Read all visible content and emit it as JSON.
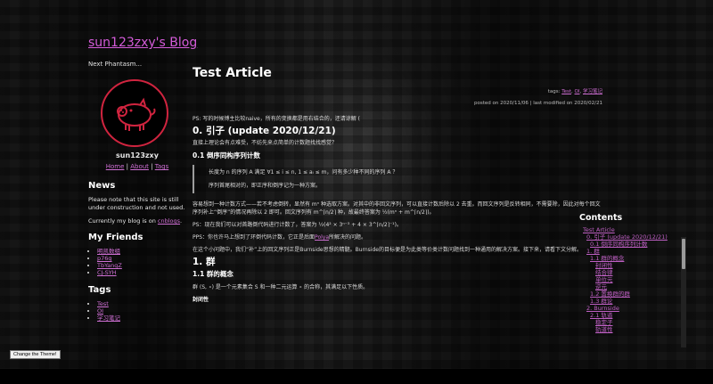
{
  "sidebar": {
    "blog_title": "sun123zxy's Blog",
    "subtitle": "Next Phantasm...",
    "username": "sun123zxy",
    "nav": {
      "home": "Home",
      "about": "About",
      "tags": "Tags"
    },
    "news": {
      "heading": "News",
      "p1": "Please note that this site is still under construction and not used.",
      "p2_prefix": "Currently my blog is on ",
      "p2_link": "cnblogs",
      "p2_suffix": "."
    },
    "friends": {
      "heading": "My Friends",
      "items": [
        "明凯数组",
        "p76g",
        "TbYangZ",
        "CJ-SYH"
      ]
    },
    "tags": {
      "heading": "Tags",
      "items": [
        "Test",
        "OI",
        "学习笔记"
      ]
    }
  },
  "article": {
    "title": "Test Article",
    "tags_label": "tags:",
    "tags": [
      "Test",
      "OI",
      "学习笔记"
    ],
    "date_line": "posted on 2020/11/06 | last modified on 2020/02/21",
    "ps1": "PS: 写的时候博主比较naive，所有的变换都是用右结合的，还请谅解 (",
    "h_intro": "0. 引子 (update 2020/12/21)",
    "intro_p": "直接上理论会有点难受，不妨先来点简单的计数题找找感觉？",
    "h_01": "0.1 倒序同构序列计数",
    "quote1": "长度为 n 的序列 A 满足 ∀1 ≤ i ≤ n, 1 ≤ aᵢ ≤ m，问有多少种不同的序列 A ？",
    "quote2": "序列首尾相对的，即正序和倒序记为一种方案。",
    "p_count": "容易想到一种计数方式——若不考虑倒转，显然有 mⁿ 种选取方案。对其中的非回文序列，可以直接计数后除以 2 去重。而回文序列是反转相同，不需要除，因此对每个回文序列补上“倒序”的情况再除以 2 即可。回文序列有 m^⌈n/2⌉ 种，故最终答案为 ½(mⁿ + m^⌈n/2⌉)。",
    "ps2": "PS：现在我们可以对首路倒代码进行计数了，答案为 ½(4² × 3ⁿ⁻³ + 4 × 3^⌈n/2⌉⁻¹)。",
    "pps_prefix": "PPS：你也许马上想到了环倒代码计数，它正是后面",
    "pps_link": "Polya",
    "pps_suffix": "所解决的问题。",
    "p_transition": "在这个小问题中，我们“补”上的回文序列正是Burnside思想的精髓。Burnside的目标便是为此类等价类计数问题找到一种通用的解决方案。接下来，请看下文分解。",
    "h_1": "1. 群",
    "h_11": "1.1 群的概念",
    "p_group": "群 (S, ∘) 是一个元素集合 S 和一种二元运算 ∘ 的合称，其满足以下性质。",
    "p_closure": "封闭性"
  },
  "toc": {
    "heading": "Contents",
    "items": [
      {
        "label": "Test Article",
        "level": 1
      },
      {
        "label": "0. 引子 (update 2020/12/21)",
        "level": 2
      },
      {
        "label": "0.1 倒序同构序列计数",
        "level": 3
      },
      {
        "label": "1. 群",
        "level": 2
      },
      {
        "label": "1.1 群的概念",
        "level": 3
      },
      {
        "label": "封闭性",
        "level": 4
      },
      {
        "label": "结合律",
        "level": 4
      },
      {
        "label": "单位元",
        "level": 4
      },
      {
        "label": "逆元",
        "level": 4
      },
      {
        "label": "1.2 置换群的群",
        "level": 3
      },
      {
        "label": "1.3 群论",
        "level": 3
      },
      {
        "label": "2. Burnside",
        "level": 2
      },
      {
        "label": "2.1 轨道",
        "level": 3
      },
      {
        "label": "稳定子",
        "level": 4
      },
      {
        "label": "轨道性",
        "level": 4
      }
    ]
  },
  "theme_button": "Change the Theme!",
  "colors": {
    "accent": "#d35bd8",
    "avatar_ring": "#d0243f",
    "text": "#e6e6e6"
  },
  "icons": {
    "avatar": "pink-pig-avatar-icon"
  }
}
